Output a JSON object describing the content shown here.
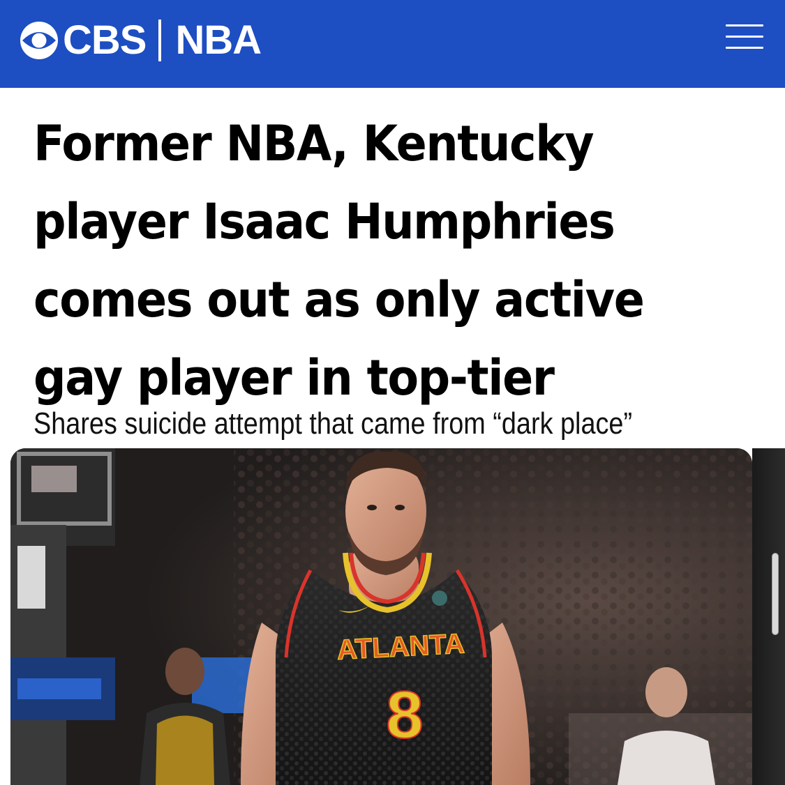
{
  "header": {
    "brand": "CBS",
    "section": "NBA",
    "background_color": "#1d4ec2",
    "logo_icon": "cbs-eye-icon",
    "menu_icon": "hamburger-menu-icon"
  },
  "article": {
    "headline_lines": [
      "Former NBA, Kentucky",
      "player Isaac Humphries",
      "comes out as only active",
      "gay player in top-tier"
    ],
    "subheadline": "Shares suicide attempt that came from “dark place”"
  },
  "hero_image": {
    "jersey_text": "ATLANTA",
    "jersey_number": "8"
  }
}
